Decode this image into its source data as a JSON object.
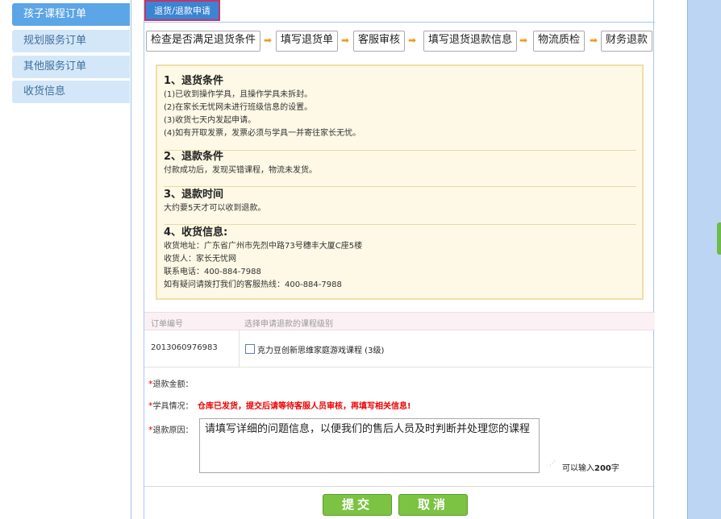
{
  "sidebar": {
    "items": [
      {
        "label": "孩子课程订单"
      },
      {
        "label": "规划服务订单"
      },
      {
        "label": "其他服务订单"
      },
      {
        "label": "收货信息"
      }
    ]
  },
  "tab": {
    "label": "退货/退款申请"
  },
  "steps": [
    "检查是否满足退货条件",
    "填写退货单",
    "客服审核",
    "填写退货退款信息",
    "物流质检",
    "财务退款"
  ],
  "info": {
    "sections": [
      {
        "title": "1、退货条件",
        "lines": [
          "(1)已收到操作学具，且操作学具未拆封。",
          "(2)在家长无忧网未进行班级信息的设置。",
          "(3)收货七天内发起申请。",
          "(4)如有开取发票，发票必须与学具一并寄往家长无忧。"
        ]
      },
      {
        "title": "2、退款条件",
        "lines": [
          "付款成功后，发现买错课程，物流未发货。"
        ]
      },
      {
        "title": "3、退款时间",
        "lines": [
          "大约要5天才可以收到退款。"
        ]
      },
      {
        "title": "4、收货信息:",
        "lines": [
          "收货地址：广东省广州市先烈中路73号穗丰大厦C座5楼",
          "收货人：家长无忧网",
          "联系电话：400-884-7988",
          "如有疑问请拨打我们的客服热线：400-884-7988"
        ]
      }
    ]
  },
  "table": {
    "headers": [
      "订单编号",
      "选择申请退款的课程级别"
    ],
    "row": {
      "order_id": "2013060976983",
      "course": "克力豆创新思维家庭游戏课程 (3级)"
    }
  },
  "form": {
    "amount_label": "退款金额：",
    "status_label": "学具情况：",
    "status_warning": "仓库已发货，提交后请等待客服人员审核，再填写相关信息!",
    "reason_label": "退款原因：",
    "reason_text": "请填写详细的问题信息，以便我们的售后人员及时判断并处理您的课程",
    "count_prefix": "可以输入",
    "count_value": "200",
    "count_suffix": "字",
    "required_mark": "*"
  },
  "buttons": {
    "submit": "提交",
    "cancel": "取消"
  }
}
